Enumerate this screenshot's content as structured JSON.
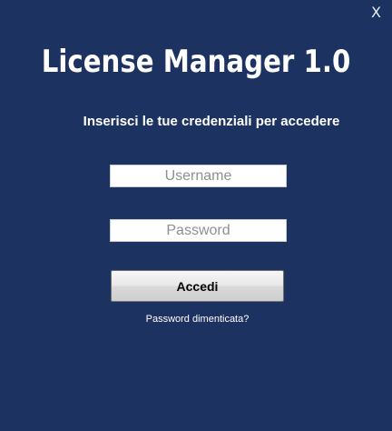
{
  "window": {
    "close_label": "X"
  },
  "header": {
    "title": "License Manager 1.0",
    "subtitle": "Inserisci le tue credenziali per accedere"
  },
  "form": {
    "username": {
      "value": "",
      "placeholder": "Username"
    },
    "password": {
      "value": "",
      "placeholder": "Password"
    },
    "submit_label": "Accedi",
    "forgot_password_label": "Password dimenticata?"
  },
  "colors": {
    "background": "#1c3260",
    "text": "#ffffff"
  }
}
